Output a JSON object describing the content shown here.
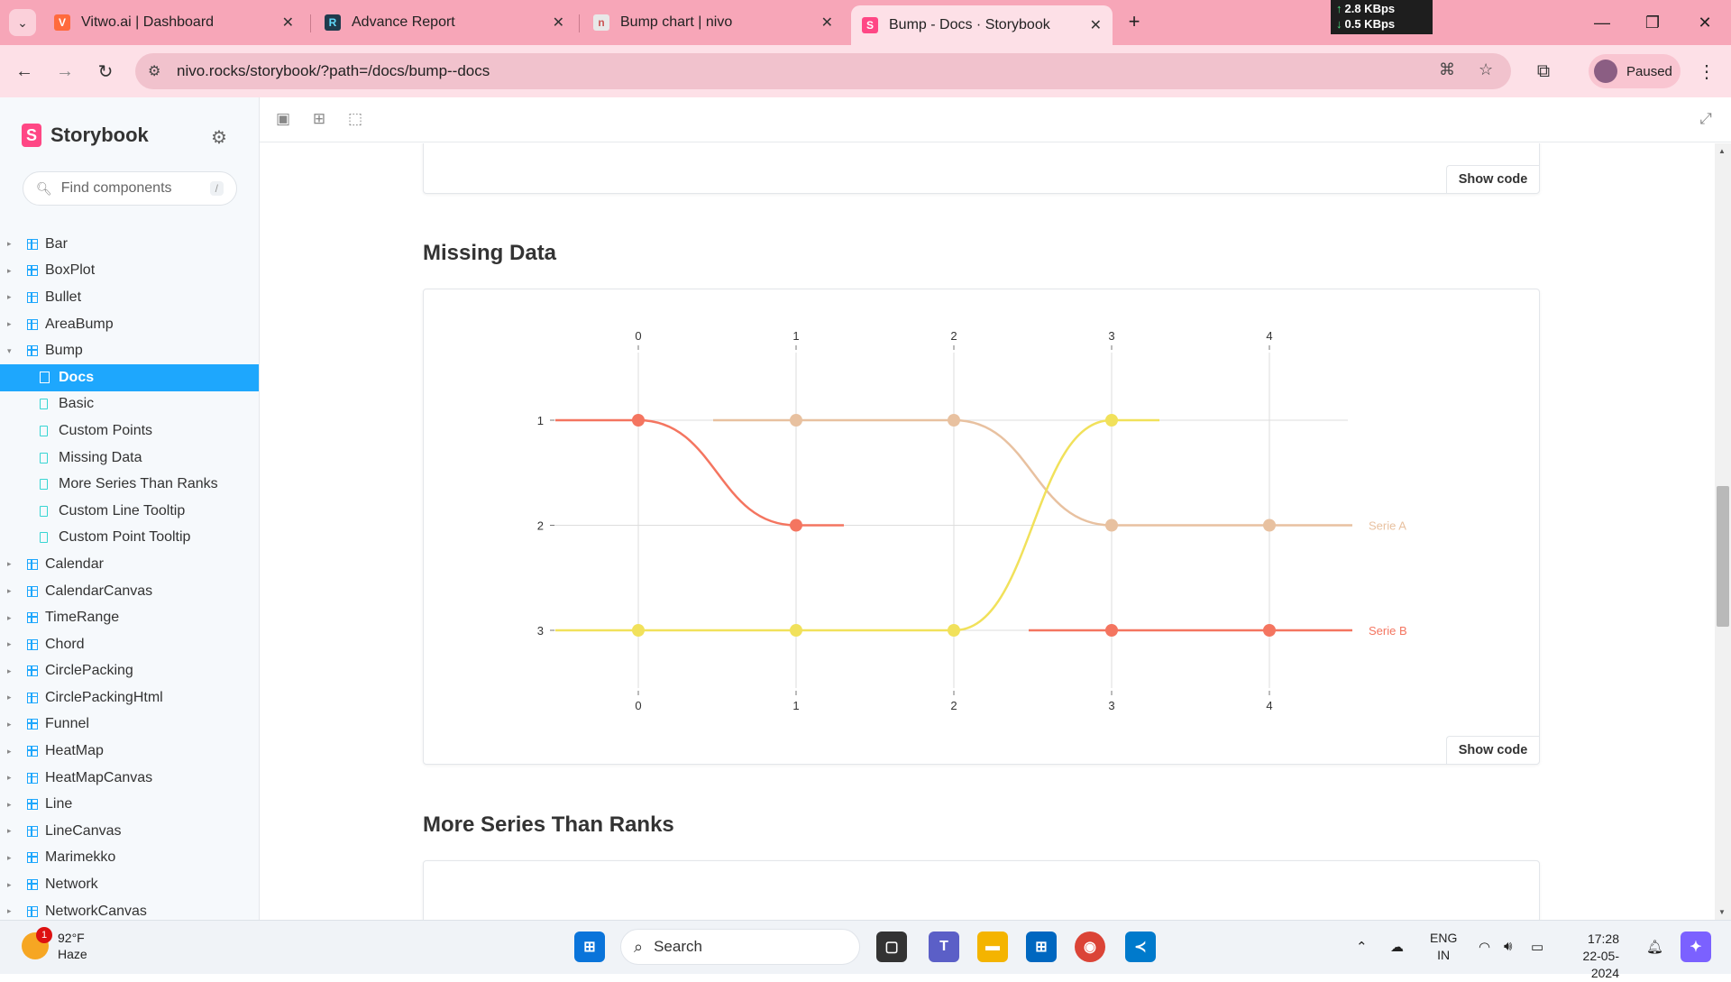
{
  "browser": {
    "tabs": [
      {
        "title": "Vitwo.ai | Dashboard",
        "favicon": "V"
      },
      {
        "title": "Advance Report",
        "favicon": "R"
      },
      {
        "title": "Bump chart | nivo",
        "favicon": "n"
      },
      {
        "title": "Bump - Docs · Storybook",
        "favicon": "S"
      }
    ],
    "net_up": "2.8 KBps",
    "net_down": "0.5 KBps",
    "url": "nivo.rocks/storybook/?path=/docs/bump--docs",
    "profile_status": "Paused",
    "accent": "#f7a6b8"
  },
  "storybook": {
    "brand": "Storybook",
    "search_placeholder": "Find components",
    "search_shortcut": "/",
    "components": [
      {
        "label": "Bar"
      },
      {
        "label": "BoxPlot"
      },
      {
        "label": "Bullet"
      },
      {
        "label": "AreaBump"
      },
      {
        "label": "Bump",
        "expanded": true,
        "stories": [
          {
            "label": "Docs",
            "active": true
          },
          {
            "label": "Basic"
          },
          {
            "label": "Custom Points"
          },
          {
            "label": "Missing Data"
          },
          {
            "label": "More Series Than Ranks"
          },
          {
            "label": "Custom Line Tooltip"
          },
          {
            "label": "Custom Point Tooltip"
          }
        ]
      },
      {
        "label": "Calendar"
      },
      {
        "label": "CalendarCanvas"
      },
      {
        "label": "TimeRange"
      },
      {
        "label": "Chord"
      },
      {
        "label": "CirclePacking"
      },
      {
        "label": "CirclePackingHtml"
      },
      {
        "label": "Funnel"
      },
      {
        "label": "HeatMap"
      },
      {
        "label": "HeatMapCanvas"
      },
      {
        "label": "Line"
      },
      {
        "label": "LineCanvas"
      },
      {
        "label": "Marimekko"
      },
      {
        "label": "Network"
      },
      {
        "label": "NetworkCanvas"
      }
    ],
    "show_code_label": "Show code",
    "sections": {
      "missing_data": "Missing Data",
      "more_series": "More Series Than Ranks"
    }
  },
  "chart_data": {
    "type": "line",
    "subtype": "bump",
    "x_ticks": [
      "0",
      "1",
      "2",
      "3",
      "4"
    ],
    "y_ticks": [
      "1",
      "2",
      "3"
    ],
    "y_inverted": true,
    "series": [
      {
        "name": "Serie A",
        "color": "#e8c1a0",
        "points": [
          {
            "x": 1,
            "y": 1
          },
          {
            "x": 2,
            "y": 1
          },
          {
            "x": 3,
            "y": 2
          },
          {
            "x": 4,
            "y": 2
          }
        ]
      },
      {
        "name": "Serie B",
        "color": "#f47560",
        "points": [
          {
            "x": 3,
            "y": 3
          },
          {
            "x": 4,
            "y": 3
          }
        ]
      },
      {
        "name": "",
        "color": "#f47560",
        "points": [
          {
            "x": 0,
            "y": 1
          },
          {
            "x": 1,
            "y": 2
          }
        ]
      },
      {
        "name": "",
        "color": "#f1e15b",
        "points": [
          {
            "x": 0,
            "y": 3
          },
          {
            "x": 1,
            "y": 3
          },
          {
            "x": 2,
            "y": 3
          },
          {
            "x": 3,
            "y": 1
          }
        ]
      }
    ]
  },
  "taskbar": {
    "temperature": "92°F",
    "condition": "Haze",
    "weather_badge": "1",
    "search_label": "Search",
    "lang_top": "ENG",
    "lang_bottom": "IN",
    "time": "17:28",
    "date": "22-05-2024"
  }
}
